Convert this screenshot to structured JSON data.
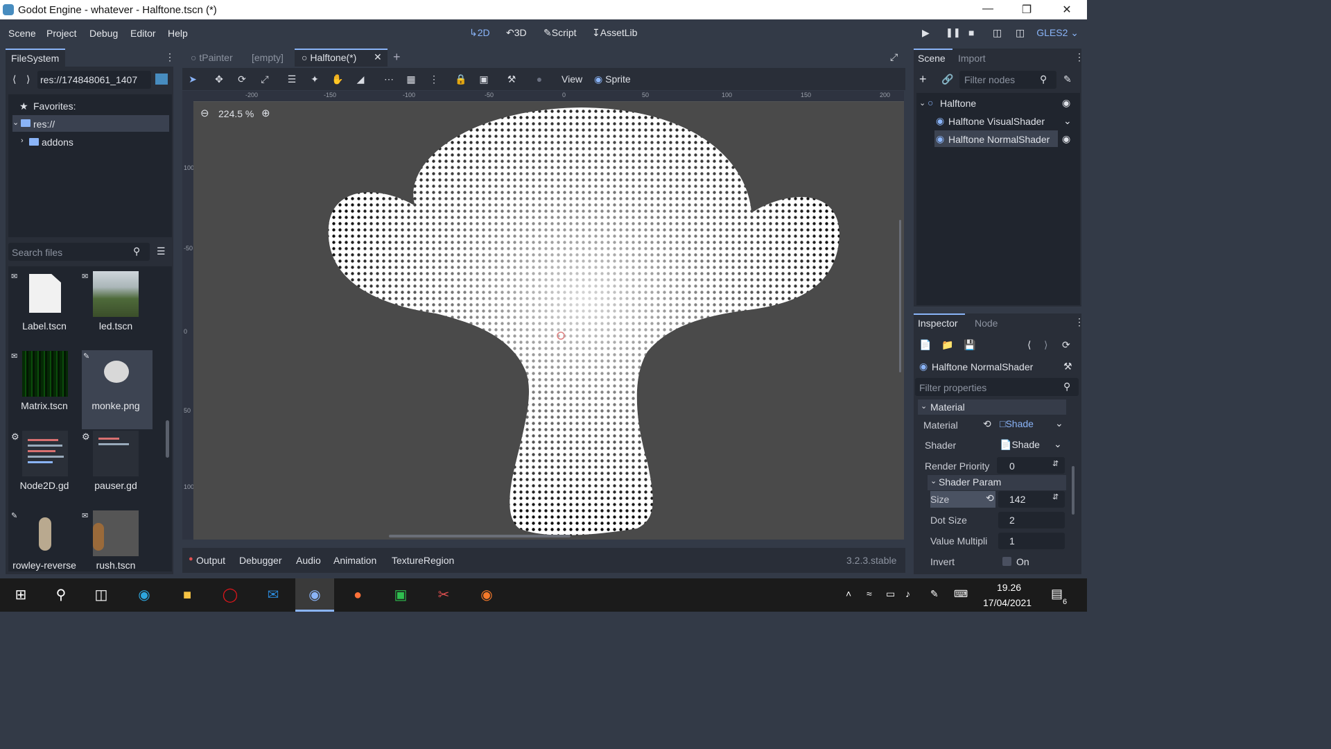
{
  "window": {
    "title": "Godot Engine - whatever - Halftone.tscn (*)"
  },
  "menu": {
    "items": [
      "Scene",
      "Project",
      "Debug",
      "Editor",
      "Help"
    ]
  },
  "modes": {
    "m2d": "2D",
    "m3d": "3D",
    "script": "Script",
    "assetlib": "AssetLib"
  },
  "renderer": "GLES2",
  "filesystem": {
    "tab": "FileSystem",
    "path": "res://174848061_1407",
    "favorites": "Favorites:",
    "root": "res://",
    "addons": "addons",
    "search_placeholder": "Search files",
    "files": [
      {
        "name": "Label.tscn",
        "icon": "file-icon"
      },
      {
        "name": "led.tscn",
        "icon": "scene-thumb"
      },
      {
        "name": "Matrix.tscn",
        "icon": "scene-thumb"
      },
      {
        "name": "monke.png",
        "icon": "image-thumb"
      },
      {
        "name": "Node2D.gd",
        "icon": "script-thumb"
      },
      {
        "name": "pauser.gd",
        "icon": "script-thumb"
      },
      {
        "name": "rowley-reverse",
        "icon": "image-thumb"
      },
      {
        "name": "rush.tscn",
        "icon": "scene-thumb"
      }
    ]
  },
  "editor_tabs": [
    {
      "label": "tPainter",
      "active": false
    },
    {
      "label": "[empty]",
      "active": false
    },
    {
      "label": "Halftone(*)",
      "active": true
    }
  ],
  "toolbar": {
    "view": "View",
    "sprite": "Sprite"
  },
  "zoom": "224.5 %",
  "ruler_h": [
    "-200",
    "-150",
    "-100",
    "-50",
    "0",
    "50",
    "100",
    "150",
    "200"
  ],
  "ruler_v": [
    "100",
    "-50",
    "0",
    "50",
    "100"
  ],
  "bottom_tabs": [
    "Output",
    "Debugger",
    "Audio",
    "Animation",
    "TextureRegion"
  ],
  "version": "3.2.3.stable",
  "scene": {
    "tabs": [
      "Scene",
      "Import"
    ],
    "filter_placeholder": "Filter nodes",
    "nodes": [
      "Halftone",
      "Halftone VisualShader",
      "Halftone NormalShader"
    ]
  },
  "inspector": {
    "tabs": [
      "Inspector",
      "Node"
    ],
    "object": "Halftone NormalShader",
    "filter_placeholder": "Filter properties",
    "section": "Material",
    "material_label": "Material",
    "material_value": "Shade",
    "shader_label": "Shader",
    "shader_value": "Shade",
    "render_priority_label": "Render Priority",
    "render_priority_value": "0",
    "shader_param": "Shader Param",
    "size_label": "Size",
    "size_value": "142",
    "dotsize_label": "Dot Size",
    "dotsize_value": "2",
    "valuemult_label": "Value Multipli",
    "valuemult_value": "1",
    "invert_label": "Invert",
    "invert_value": "On"
  },
  "taskbar": {
    "time": "19.26",
    "date": "17/04/2021",
    "notifications": "6"
  },
  "colors": {
    "accent": "#8ab4f8",
    "panel": "#292e38",
    "bg": "#333a47"
  }
}
